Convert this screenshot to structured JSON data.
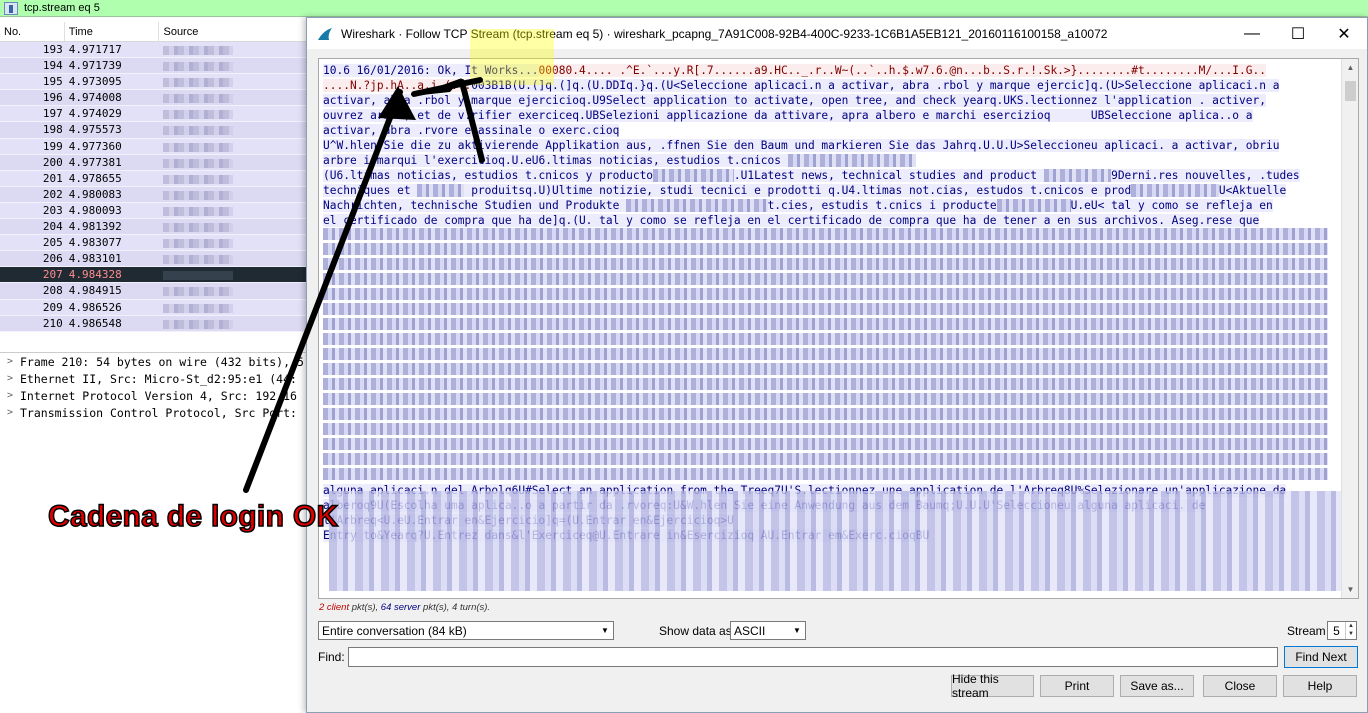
{
  "filter_bar": {
    "text": "tcp.stream eq 5"
  },
  "packet_list": {
    "headers": [
      "No.",
      "Time",
      "Source"
    ],
    "rows": [
      {
        "no": "193",
        "time": "4.971717"
      },
      {
        "no": "194",
        "time": "4.971739"
      },
      {
        "no": "195",
        "time": "4.973095"
      },
      {
        "no": "196",
        "time": "4.974008"
      },
      {
        "no": "197",
        "time": "4.974029"
      },
      {
        "no": "198",
        "time": "4.975573"
      },
      {
        "no": "199",
        "time": "4.977360"
      },
      {
        "no": "200",
        "time": "4.977381"
      },
      {
        "no": "201",
        "time": "4.978655"
      },
      {
        "no": "202",
        "time": "4.980083"
      },
      {
        "no": "203",
        "time": "4.980093"
      },
      {
        "no": "204",
        "time": "4.981392"
      },
      {
        "no": "205",
        "time": "4.983077"
      },
      {
        "no": "206",
        "time": "4.983101"
      },
      {
        "no": "207",
        "time": "4.984328",
        "selected": true
      },
      {
        "no": "208",
        "time": "4.984915"
      },
      {
        "no": "209",
        "time": "4.986526"
      },
      {
        "no": "210",
        "time": "4.986548"
      }
    ]
  },
  "detail_pane": {
    "rows": [
      "Frame 210: 54 bytes on wire (432 bits), 5",
      "Ethernet II, Src: Micro-St_d2:95:e1 (44:",
      "Internet Protocol Version 4, Src: 192.16",
      "Transmission Control Protocol, Src Port:"
    ]
  },
  "dialog": {
    "title": "Wireshark · Follow TCP Stream (tcp.stream eq 5) · wireshark_pcapng_7A91C008-92B4-400C-9233-1C6B1A5EB121_20160116100158_a10072",
    "minimize": "—",
    "maximize": "☐",
    "close": "✕",
    "stream_lines": [
      {
        "seg": [
          {
            "cls": "srv",
            "t": "10.6 16/01/2016: Ok, It Works..."
          },
          {
            "cls": "cli",
            "t": "00080.4.... .^E.`...y.R[.7......a9.HC.._.r..W~(..`..h.$.w7.6.@n...b..S.r.!.Sk.>}........#t........M/...I.G.."
          }
        ]
      },
      {
        "seg": [
          {
            "cls": "cli",
            "t": "....N.?jp.hA..a.i.(..."
          },
          {
            "cls": "srv",
            "t": "003B1B(U.(]q.(]q.(U.DDIq.}q.(U<Seleccione aplicaci.n a activar, abra .rbol y marque ejercic]q.(U>Seleccione aplicaci.n a"
          }
        ]
      },
      {
        "seg": [
          {
            "cls": "srv",
            "t": "activar, abra .rbol y marque ejercicioq.U9Select application to activate, open tree, and check yearq.UKS.lectionnez l'application . activer,"
          }
        ]
      },
      {
        "seg": [
          {
            "cls": "srv",
            "t": "ouvrez arbre, et de v.rifier exerciceq.UBSelezioni applicazione da attivare, apra albero e marchi esercizioq      UBSeleccione aplica..o a"
          }
        ]
      },
      {
        "seg": [
          {
            "cls": "srv",
            "t": "activar, abra .rvore e assinale o exerc.cioq"
          }
        ]
      },
      {
        "seg": [
          {
            "cls": "srv",
            "t": "U^W.hlen Sie die zu aktivierende Applikation aus, .ffnen Sie den Baum und markieren Sie das Jahrq.U.U.U>Seleccioneu aplicaci. a activar, obriu"
          }
        ]
      },
      {
        "seg": [
          {
            "cls": "srv",
            "t": "arbre i marqui l'exercicioq.U.eU6.ltimas noticias, estudios t.cnicos "
          },
          {
            "cls": "blur",
            "t": "xxxxxxxxxxxxxxxxxxx"
          }
        ]
      },
      {
        "seg": [
          {
            "cls": "srv",
            "t": "(U6.ltimas noticias, estudios t.cnicos y producto"
          },
          {
            "cls": "blur",
            "t": "xxxxxxxxxxxx"
          },
          {
            "cls": "srv",
            "t": ".U1Latest news, technical studies and product "
          },
          {
            "cls": "blur",
            "t": "xxxxxxxxxx"
          },
          {
            "cls": "srv",
            "t": "9Derni.res nouvelles, .tudes"
          }
        ]
      },
      {
        "seg": [
          {
            "cls": "srv",
            "t": "techniques et "
          },
          {
            "cls": "blur",
            "t": "xxxxxxx"
          },
          {
            "cls": "srv",
            "t": " produitsq.U)Ultime notizie, studi tecnici e prodotti q.U4.ltimas not.cias, estudos t.cnicos e prod"
          },
          {
            "cls": "blur",
            "t": "xxxxxxxxxxxxx"
          },
          {
            "cls": "srv",
            "t": "U<Aktuelle"
          }
        ]
      },
      {
        "seg": [
          {
            "cls": "srv",
            "t": "Nachrichten, technische Studien und Produkte "
          },
          {
            "cls": "blur",
            "t": "xxxxxxxxxxxxxxxxxxxxx"
          },
          {
            "cls": "srv",
            "t": "t.cies, estudis t.cnics i producte"
          },
          {
            "cls": "blur",
            "t": "xxxxxxxxxxx"
          },
          {
            "cls": "srv",
            "t": "U.eU< tal y como se refleja en"
          }
        ]
      },
      {
        "seg": [
          {
            "cls": "srv",
            "t": "el certificado de compra que ha de]q.(U. tal y como se refleja en el certificado de compra que ha de tener a en sus archivos. Aseg.rese que"
          }
        ]
      },
      {
        "blur": true
      },
      {
        "blur": true
      },
      {
        "blur": true
      },
      {
        "blur": true
      },
      {
        "blur": true
      },
      {
        "blur": true
      },
      {
        "blur": true
      },
      {
        "blur": true
      },
      {
        "blur": true
      },
      {
        "blur": true
      },
      {
        "blur": true
      },
      {
        "blur": true
      },
      {
        "blur": true
      },
      {
        "blur": true
      },
      {
        "blur": true
      },
      {
        "blur": true
      },
      {
        "blur": true
      },
      {
        "seg": [
          {
            "cls": "srv",
            "t": "alguna aplicaci.n del Arbolq6U#Select an application from the Treeq7U'S.lectionnez une application de l'Arbreq8U%Selezionare un'applicazione da"
          }
        ]
      },
      {
        "seg": [
          {
            "cls": "srv",
            "t": "alberoq9U(Escolha uma aplica..o a partir da .rvoreq:U&W.hlen Sie eine Anwendung aus dem Baumq;U.U.U'Seleccioneu alguna aplicaci. de"
          }
        ]
      },
      {
        "seg": [
          {
            "cls": "srv",
            "t": "l'Arbreq<U.eU.Entrar en&Ejercicio]q=(U.Entrar en&Ejercicioq>U"
          }
        ]
      },
      {
        "seg": [
          {
            "cls": "srv",
            "t": "Entry to&Yearq?U.Entrez dans&l'Exerciceq@U.Entrare in&Esercizioq AU.Entrar em&Exerc.cioqBU"
          }
        ]
      }
    ],
    "packet_summary": {
      "client": "2 client",
      "client_tail": " pkt(s), ",
      "server": "64 server",
      "server_tail": " pkt(s), 4 turn(s)."
    },
    "conversation": "Entire conversation (84 kB)",
    "show_data_label": "Show data as",
    "show_data_value": "ASCII",
    "stream_label": "Stream",
    "stream_value": "5",
    "find_label": "Find:",
    "find_value": "",
    "buttons": {
      "find_next": "Find Next",
      "hide": "Hide this stream",
      "print": "Print",
      "save": "Save as...",
      "close": "Close",
      "help": "Help"
    }
  },
  "annotation": {
    "label": "Cadena de login OK",
    "color": "#e00000"
  }
}
